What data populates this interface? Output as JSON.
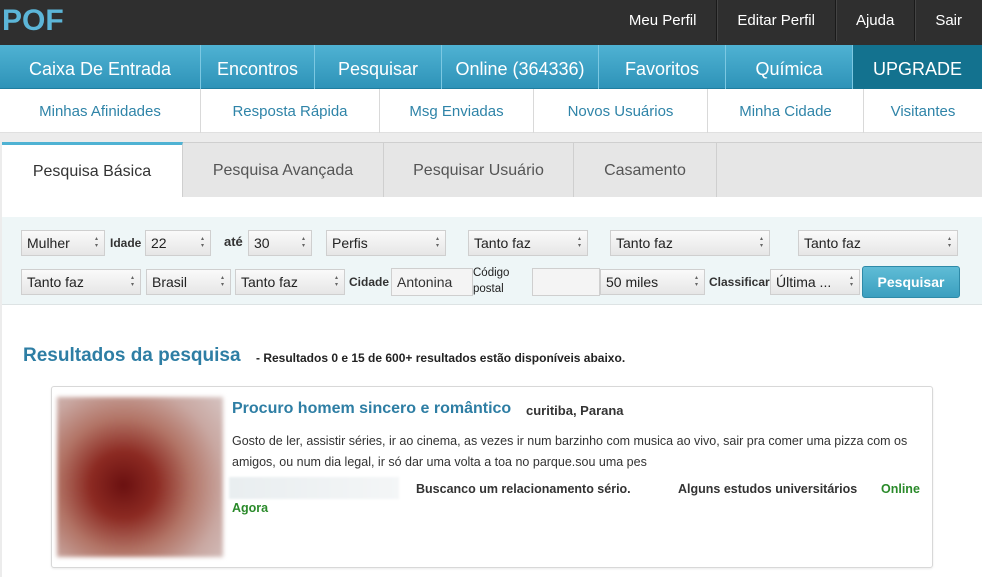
{
  "brand": {
    "logo": "POF"
  },
  "topnav": [
    "Meu Perfil",
    "Editar Perfil",
    "Ajuda",
    "Sair"
  ],
  "mainnav": [
    "Caixa De Entrada",
    "Encontros",
    "Pesquisar",
    "Online (364336)",
    "Favoritos",
    "Química",
    "UPGRADE"
  ],
  "subnav": [
    "Minhas Afinidades",
    "Resposta Rápida",
    "Msg Enviadas",
    "Novos Usuários",
    "Minha Cidade",
    "Visitantes"
  ],
  "tabs": [
    "Pesquisa Básica",
    "Pesquisa Avançada",
    "Pesquisar Usuário",
    "Casamento"
  ],
  "filters": {
    "gender": "Mulher",
    "age_label": "Idade",
    "age_from": "22",
    "age_to_label": "até",
    "age_to": "30",
    "profiles": "Perfis",
    "opt1": "Tanto faz",
    "opt2": "Tanto faz",
    "opt3": "Tanto faz",
    "opt4": "Tanto faz",
    "country": "Brasil",
    "opt5": "Tanto faz",
    "city_label": "Cidade",
    "city": "Antonina",
    "postal_label": "Código postal",
    "postal": "",
    "distance": "50 miles",
    "sort_label": "Classificar",
    "sort": "Última ...",
    "search_button": "Pesquisar"
  },
  "results": {
    "title": "Resultados da pesquisa",
    "subtitle": "- Resultados 0 e 15 de 600+ resultados estão disponíveis abaixo."
  },
  "cards": [
    {
      "headline": "Procuro homem sincero e romântico",
      "location": "curitiba, Parana",
      "description": "Gosto de ler, assistir séries, ir ao cinema, as vezes ir num barzinho com musica ao vivo, sair pra comer uma pizza com os amigos, ou num dia legal, ir só dar uma volta a toa no parque.sou uma pes",
      "seeking": "Buscanco um relacionamento sério.",
      "education": "Alguns estudos universitários",
      "status_line1": "Online",
      "status_line2": "Agora"
    }
  ],
  "colors": {
    "accent": "#3aa3c6",
    "topbar": "#2f2f2f",
    "online": "#2a8a2a",
    "link": "#2e7ea4"
  }
}
